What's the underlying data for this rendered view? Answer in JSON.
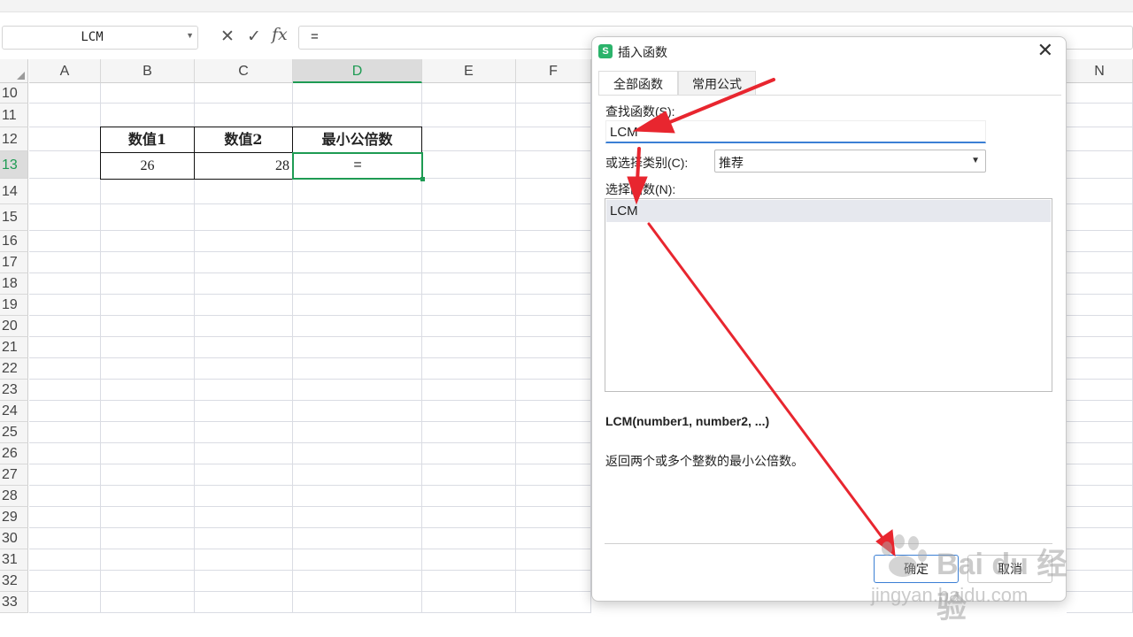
{
  "formula_bar": {
    "name_box": "LCM",
    "cancel_icon": "close-icon",
    "enter_icon": "check-icon",
    "fx_label": "fx",
    "content": "="
  },
  "sheet": {
    "columns": [
      "A",
      "B",
      "C",
      "D",
      "E",
      "F",
      "N"
    ],
    "rows": [
      "10",
      "11",
      "12",
      "13",
      "14",
      "15",
      "16",
      "17",
      "18",
      "19",
      "20",
      "21",
      "22",
      "23",
      "24",
      "25",
      "26",
      "27",
      "28",
      "29",
      "30",
      "31",
      "32",
      "33"
    ],
    "selected_column": "D",
    "selected_row": "13",
    "table": {
      "headers": [
        "数值1",
        "数值2",
        "最小公倍数"
      ],
      "values": [
        "26",
        "28",
        "="
      ]
    }
  },
  "dialog": {
    "title": "插入函数",
    "tabs": [
      "全部函数",
      "常用公式"
    ],
    "active_tab": "全部函数",
    "search_label": "查找函数(S):",
    "search_value": "LCM",
    "category_label": "或选择类别(C):",
    "category_value": "推荐",
    "function_list_label": "选择函数(N):",
    "functions": [
      "LCM"
    ],
    "syntax": "LCM(number1, number2, ...)",
    "description": "返回两个或多个整数的最小公倍数。",
    "ok_label": "确定",
    "cancel_label": "取消"
  },
  "watermark": {
    "brand": "Bai du 经验",
    "url": "jingyan.baidu.com"
  },
  "colors": {
    "accent_green": "#1e9b53",
    "annotation_red": "#e8262f",
    "focus_blue": "#3b7fd4"
  }
}
